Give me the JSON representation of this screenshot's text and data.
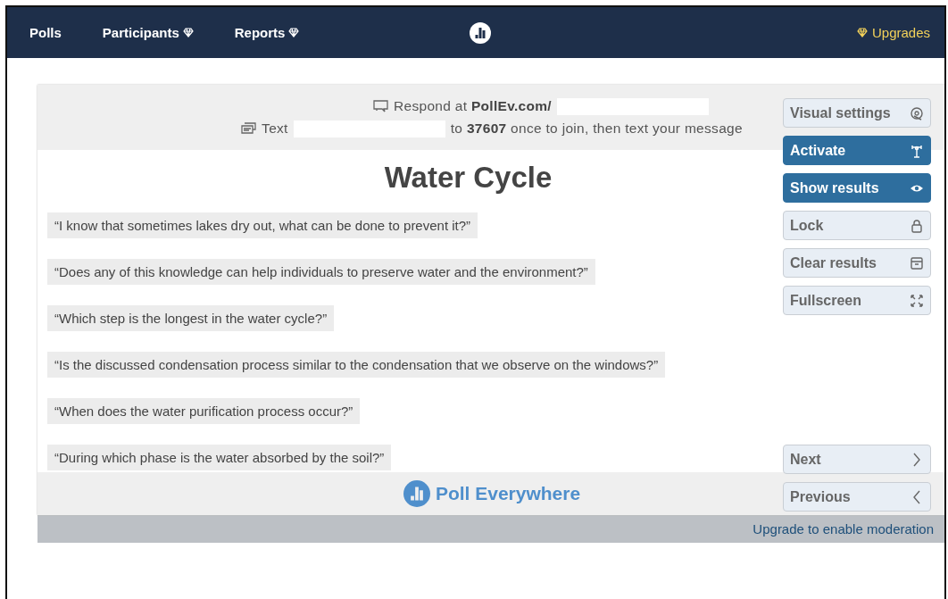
{
  "nav": {
    "items": [
      {
        "label": "Polls",
        "premium": false
      },
      {
        "label": "Participants",
        "premium": true
      },
      {
        "label": "Reports",
        "premium": true
      }
    ],
    "upgrades": {
      "label": "Upgrades",
      "premium": true
    }
  },
  "header": {
    "respond": "Respond at **PollEv.com/**",
    "text_prefix": "Text",
    "text_suffix": "to **37607** once to join, then text your message"
  },
  "title": "Water Cycle",
  "responses": [
    "“I know that sometimes lakes dry out, what can be done to prevent it?”",
    "“Does any of this knowledge can help individuals to preserve water and the environment?”",
    "“Which step is the longest in the water cycle?”",
    "“Is the discussed condensation process similar to the condensation that we observe on the windows?”",
    "“When does the water purification process occur?”",
    "“During which phase is the water absorbed by the soil?”"
  ],
  "actions": [
    {
      "label": "Visual settings",
      "kind": "default"
    },
    {
      "label": "Activate",
      "kind": "primary"
    },
    {
      "label": "Show results",
      "kind": "primary"
    },
    {
      "label": "Lock",
      "kind": "default"
    },
    {
      "label": "Clear results",
      "kind": "default"
    },
    {
      "label": "Fullscreen",
      "kind": "default"
    }
  ],
  "navigation": [
    "Next",
    "Previous"
  ],
  "brand": "Poll Everywhere",
  "moderation_link": "Upgrade to enable moderation"
}
